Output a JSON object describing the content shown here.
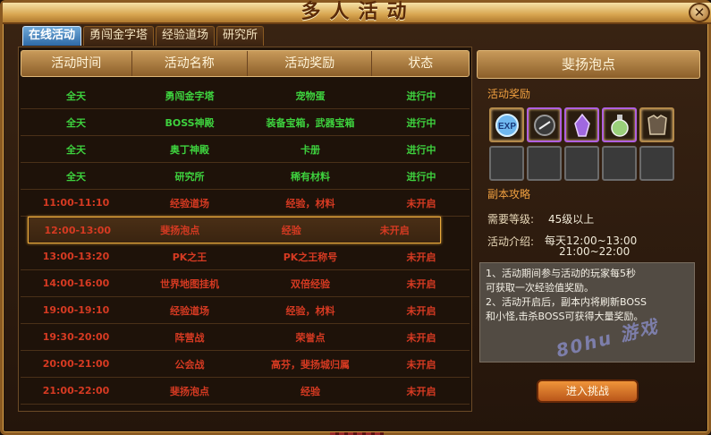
{
  "window": {
    "title": "多人活动",
    "close_label": "✕"
  },
  "tabs": [
    {
      "label": "在线活动",
      "active": true
    },
    {
      "label": "勇闯金字塔",
      "active": false
    },
    {
      "label": "经验道场",
      "active": false
    },
    {
      "label": "研究所",
      "active": false
    }
  ],
  "table": {
    "headers": [
      "活动时间",
      "活动名称",
      "活动奖励",
      "状态"
    ],
    "rows": [
      {
        "time": "全天",
        "name": "勇闯金字塔",
        "reward": "宠物蛋",
        "status": "进行中"
      },
      {
        "time": "全天",
        "name": "BOSS神殿",
        "reward": "装备宝箱，武器宝箱",
        "status": "进行中"
      },
      {
        "time": "全天",
        "name": "奥丁神殿",
        "reward": "卡册",
        "status": "进行中"
      },
      {
        "time": "全天",
        "name": "研究所",
        "reward": "稀有材料",
        "status": "进行中"
      },
      {
        "time": "11:00-11:10",
        "name": "经验道场",
        "reward": "经验，材料",
        "status": "未开启"
      },
      {
        "time": "12:00-13:00",
        "name": "斐扬泡点",
        "reward": "经验",
        "status": "未开启"
      },
      {
        "time": "13:00-13:20",
        "name": "PK之王",
        "reward": "PK之王称号",
        "status": "未开启"
      },
      {
        "time": "14:00-16:00",
        "name": "世界地图挂机",
        "reward": "双倍经验",
        "status": "未开启"
      },
      {
        "time": "19:00-19:10",
        "name": "经验道场",
        "reward": "经验，材料",
        "status": "未开启"
      },
      {
        "time": "19:30-20:00",
        "name": "阵营战",
        "reward": "荣誉点",
        "status": "未开启"
      },
      {
        "time": "20:00-21:00",
        "name": "公会战",
        "reward": "高芬，斐扬城归属",
        "status": "未开启"
      },
      {
        "time": "21:00-22:00",
        "name": "斐扬泡点",
        "reward": "经验",
        "status": "未开启"
      }
    ],
    "selected_index": 5
  },
  "detail": {
    "title": "斐扬泡点",
    "reward_label": "活动奖励",
    "reward_icons": [
      "exp-orb-icon",
      "dark-orb-icon",
      "purple-crystal-icon",
      "potion-bottle-icon",
      "armor-chest-icon"
    ],
    "empty_slots": 5,
    "guide_label": "副本攻略",
    "level_label": "需要等级:",
    "level_value": "45级以上",
    "intro_label": "活动介绍:",
    "intro_line1": "每天12:00~13:00",
    "intro_line2": "21:00~22:00",
    "desc_lines": [
      "1、活动期间参与活动的玩家每5秒",
      "可获取一次经验值奖励。",
      "2、活动开启后，副本内将刷新BOSS",
      "和小怪,击杀BOSS可获得大量奖励。"
    ],
    "enter_label": "进入挑战",
    "watermark": "80hu 游戏"
  },
  "colors": {
    "active_status": "#3ed23e",
    "inactive_status": "#d63a22",
    "highlight": "#e8a83a"
  }
}
